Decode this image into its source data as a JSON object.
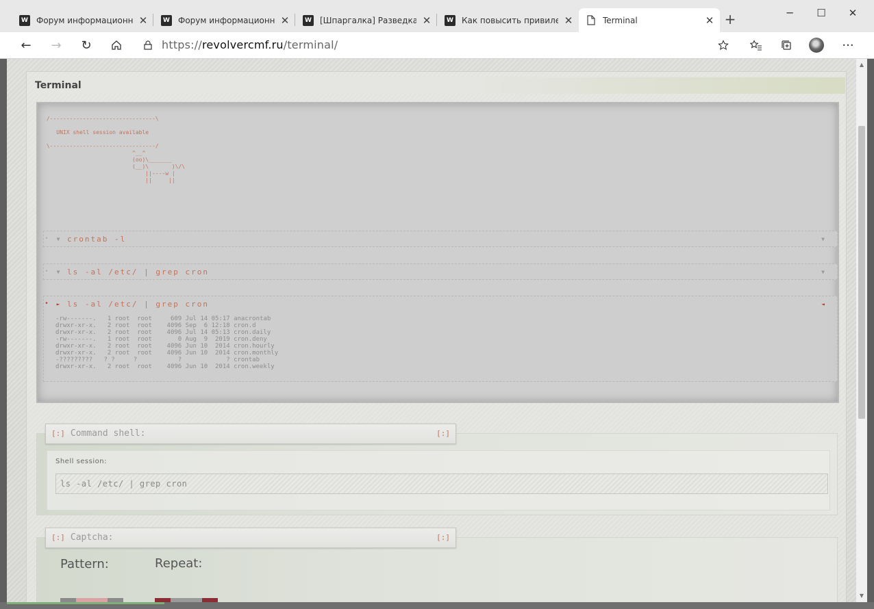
{
  "browser": {
    "tabs": [
      {
        "label": "Форум информационной",
        "icon": "w-logo-icon",
        "active": false
      },
      {
        "label": "Форум информационной",
        "icon": "w-logo-icon",
        "active": false
      },
      {
        "label": "[Шпаргалка] Разведка и а",
        "icon": "w-logo-icon",
        "active": false
      },
      {
        "label": "Как повысить привилеги",
        "icon": "w-logo-icon",
        "active": false
      },
      {
        "label": "Terminal",
        "icon": "page-icon",
        "active": true
      }
    ],
    "new_tab": "+",
    "window": {
      "minimize": "─",
      "maximize": "☐",
      "close": "✕"
    },
    "address": {
      "scheme": "https://",
      "host": "revolvercmf.ru",
      "path": "/terminal/"
    },
    "toolbar": {
      "back": "←",
      "forward": "→",
      "reload": "↻",
      "home": "⌂",
      "more": "···"
    }
  },
  "page": {
    "title": "Terminal",
    "ascii_art": " /--------------------------------\\\n\n    UNIX shell session available\n\n \\--------------------------------/\n                           ^__^\n                           (oo)\\_______\n                           (__)\\       )\\/\\\n                               ||----w |\n                               ||     ||",
    "commands": [
      {
        "text": "crontab -l",
        "expanded": false,
        "marker_color": "#b0b0b0",
        "output": []
      },
      {
        "text": "ls -al /etc/ | grep cron",
        "expanded": false,
        "marker_color": "#b0b0b0",
        "output": []
      },
      {
        "text": "ls -al /etc/ | grep cron",
        "expanded": true,
        "marker_color": "#c03a2b",
        "output": [
          "-rw-------.   1 root  root     609 Jul 14 05:17 anacrontab",
          "drwxr-xr-x.   2 root  root    4096 Sep  6 12:18 cron.d",
          "drwxr-xr-x.   2 root  root    4096 Jul 14 05:13 cron.daily",
          "-rw-------.   1 root  root       0 Aug  9  2019 cron.deny",
          "drwxr-xr-x.   2 root  root    4096 Jun 10  2014 cron.hourly",
          "drwxr-xr-x.   2 root  root    4096 Jun 10  2014 cron.monthly",
          "-?????????   ? ?     ?           ?            ? crontab",
          "drwxr-xr-x.   2 root  root    4096 Jun 10  2014 cron.weekly"
        ]
      }
    ],
    "command_shell": {
      "header": "Command shell:",
      "toggle": "[:]",
      "session_label": "Shell session:",
      "input_value": "ls -al /etc/ | grep cron"
    },
    "captcha": {
      "header": "Captcha:",
      "toggle": "[:]",
      "pattern_label": "Pattern:",
      "repeat_label": "Repeat:",
      "pattern_colors": [
        "#8a8a8a",
        "#d9a3a3",
        "#d9a3a3",
        "#8a8a8a"
      ],
      "repeat_colors": [
        "#8a2d35",
        "#9a9a9a",
        "#9a9a9a",
        "#8a2d35"
      ]
    }
  }
}
